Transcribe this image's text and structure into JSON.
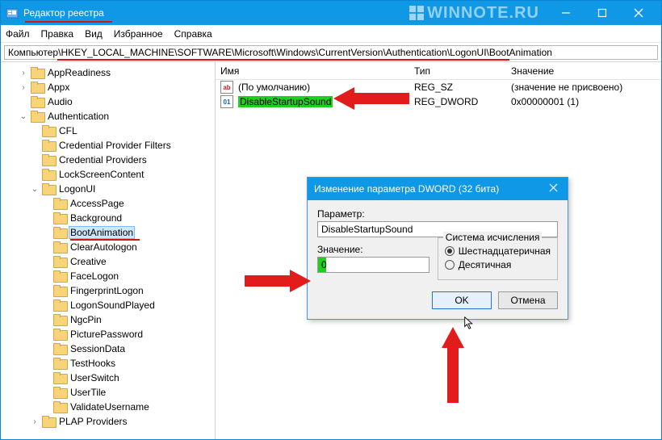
{
  "window": {
    "title": "Редактор реестра",
    "watermark": "WINNOTE.RU"
  },
  "menu": [
    "Файл",
    "Правка",
    "Вид",
    "Избранное",
    "Справка"
  ],
  "address": "Компьютер\\HKEY_LOCAL_MACHINE\\SOFTWARE\\Microsoft\\Windows\\CurrentVersion\\Authentication\\LogonUI\\BootAnimation",
  "tree": [
    {
      "ind": 2,
      "t": ">",
      "label": "AppReadiness"
    },
    {
      "ind": 2,
      "t": ">",
      "label": "Appx"
    },
    {
      "ind": 2,
      "t": " ",
      "label": "Audio"
    },
    {
      "ind": 2,
      "t": "v",
      "label": "Authentication"
    },
    {
      "ind": 3,
      "t": " ",
      "label": "CFL"
    },
    {
      "ind": 3,
      "t": " ",
      "label": "Credential Provider Filters"
    },
    {
      "ind": 3,
      "t": " ",
      "label": "Credential Providers"
    },
    {
      "ind": 3,
      "t": " ",
      "label": "LockScreenContent"
    },
    {
      "ind": 3,
      "t": "v",
      "label": "LogonUI"
    },
    {
      "ind": 4,
      "t": " ",
      "label": "AccessPage"
    },
    {
      "ind": 4,
      "t": " ",
      "label": "Background"
    },
    {
      "ind": 4,
      "t": " ",
      "label": "BootAnimation",
      "sel": true,
      "redline": true
    },
    {
      "ind": 4,
      "t": " ",
      "label": "ClearAutologon"
    },
    {
      "ind": 4,
      "t": " ",
      "label": "Creative"
    },
    {
      "ind": 4,
      "t": " ",
      "label": "FaceLogon"
    },
    {
      "ind": 4,
      "t": " ",
      "label": "FingerprintLogon"
    },
    {
      "ind": 4,
      "t": " ",
      "label": "LogonSoundPlayed"
    },
    {
      "ind": 4,
      "t": " ",
      "label": "NgcPin"
    },
    {
      "ind": 4,
      "t": " ",
      "label": "PicturePassword"
    },
    {
      "ind": 4,
      "t": " ",
      "label": "SessionData"
    },
    {
      "ind": 4,
      "t": " ",
      "label": "TestHooks"
    },
    {
      "ind": 4,
      "t": " ",
      "label": "UserSwitch"
    },
    {
      "ind": 4,
      "t": " ",
      "label": "UserTile"
    },
    {
      "ind": 4,
      "t": " ",
      "label": "ValidateUsername"
    },
    {
      "ind": 3,
      "t": ">",
      "label": "PLAP Providers"
    }
  ],
  "list": {
    "headers": {
      "name": "Имя",
      "type": "Тип",
      "value": "Значение"
    },
    "rows": [
      {
        "icon": "str",
        "name": "(По умолчанию)",
        "type": "REG_SZ",
        "value": "(значение не присвоено)",
        "hl": false
      },
      {
        "icon": "bin",
        "name": "DisableStartupSound",
        "type": "REG_DWORD",
        "value": "0x00000001 (1)",
        "hl": true
      }
    ]
  },
  "dialog": {
    "title": "Изменение параметра DWORD (32 бита)",
    "paramLabel": "Параметр:",
    "paramValue": "DisableStartupSound",
    "valueLabel": "Значение:",
    "valueValue": "0",
    "groupLabel": "Система исчисления",
    "radioHex": "Шестнадцатеричная",
    "radioDec": "Десятичная",
    "ok": "OK",
    "cancel": "Отмена"
  }
}
